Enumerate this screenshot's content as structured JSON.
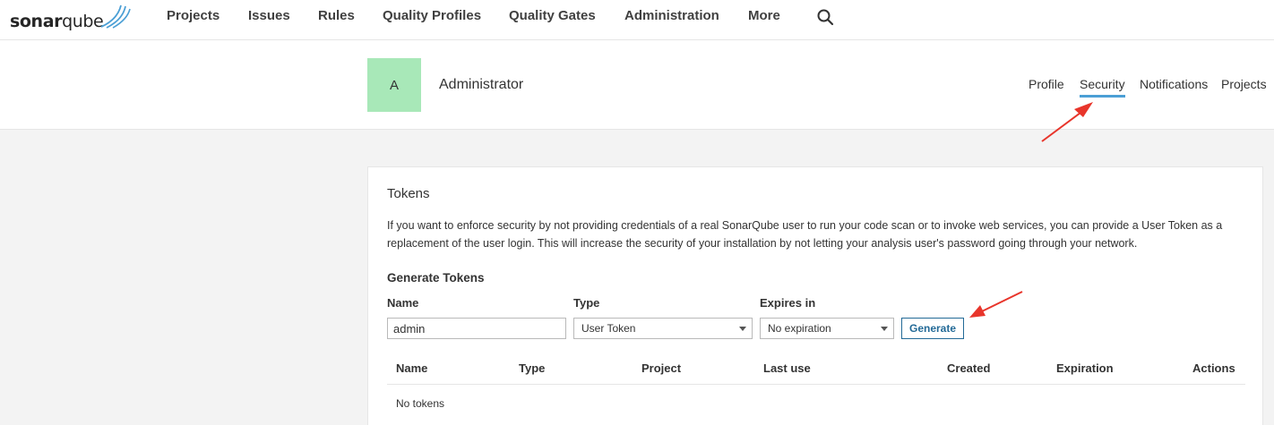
{
  "brand": {
    "prefix": "sonar",
    "suffix": "qube",
    "color": "#4b9fd5"
  },
  "nav": {
    "items": [
      "Projects",
      "Issues",
      "Rules",
      "Quality Profiles",
      "Quality Gates",
      "Administration",
      "More"
    ]
  },
  "account": {
    "avatar_letter": "A",
    "avatar_color": "#a8e8b8",
    "name": "Administrator",
    "tabs": [
      "Profile",
      "Security",
      "Notifications",
      "Projects"
    ],
    "active_tab": "Security"
  },
  "tokens": {
    "title": "Tokens",
    "description": "If you want to enforce security by not providing credentials of a real SonarQube user to run your code scan or to invoke web services, you can provide a User Token as a replacement of the user login. This will increase the security of your installation by not letting your analysis user's password going through your network.",
    "generate_title": "Generate Tokens",
    "labels": {
      "name": "Name",
      "type": "Type",
      "expires": "Expires in"
    },
    "name_value": "admin",
    "type_value": "User Token",
    "expires_value": "No expiration",
    "generate_label": "Generate",
    "columns": [
      "Name",
      "Type",
      "Project",
      "Last use",
      "Created",
      "Expiration",
      "Actions"
    ],
    "empty_text": "No tokens"
  },
  "colors": {
    "accent": "#4b9fd5",
    "annotation": "#e8352b",
    "button": "#236a97"
  }
}
